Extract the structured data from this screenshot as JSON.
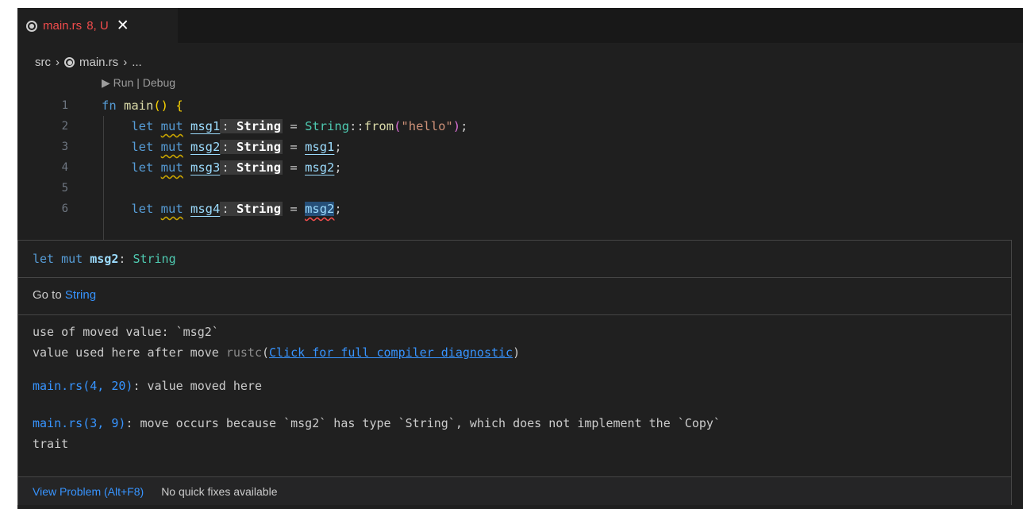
{
  "tab": {
    "icon": "rust-icon",
    "name": "main.rs",
    "badge": "8, U",
    "close_glyph": "✕"
  },
  "breadcrumb": {
    "folder": "src",
    "separator": "›",
    "file": "main.rs",
    "more": "..."
  },
  "codelens": "▶ Run | Debug",
  "code": {
    "lines": [
      {
        "number": "1"
      },
      {
        "number": "2"
      },
      {
        "number": "3"
      },
      {
        "number": "4"
      },
      {
        "number": "5"
      },
      {
        "number": "6"
      }
    ],
    "tokens": {
      "fn": "fn",
      "main": "main",
      "open": "()",
      "brace": "{",
      "let": "let",
      "mut": "mut",
      "msg1": "msg1",
      "msg2": "msg2",
      "msg3": "msg3",
      "msg4": "msg4",
      "colon": ":",
      "string_type": "String",
      "eq": "=",
      "string_ns": "String",
      "path_sep": "::",
      "from": "from",
      "lparen": "(",
      "literal": "\"hello\"",
      "rparen": ")",
      "semi": ";"
    }
  },
  "hover": {
    "signature": {
      "prefix": "let mut ",
      "name": "msg2",
      "colon": ": ",
      "type": "String"
    },
    "goto": {
      "label": "Go to",
      "target": "String"
    },
    "error": {
      "line1": "use of moved value: `msg2`",
      "line2_prefix": "value used here after move ",
      "source": "rustc",
      "lparen": "(",
      "diag_link": "Click for full compiler diagnostic",
      "rparen": ")"
    },
    "related": [
      {
        "loc": "main.rs(4, 20)",
        "text": ": value moved here"
      },
      {
        "loc": "main.rs(3, 9)",
        "text": ": move occurs because `msg2` has type `String`, which does not implement the `Copy`",
        "text2": "trait"
      }
    ],
    "footer": {
      "view_problem": "View Problem (Alt+F8)",
      "no_fixes": "No quick fixes available"
    }
  }
}
